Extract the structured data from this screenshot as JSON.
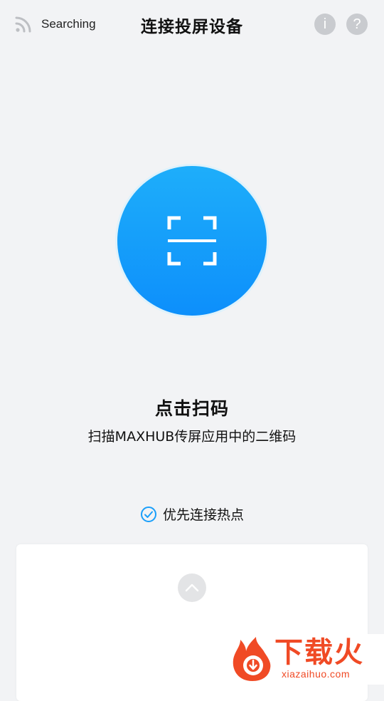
{
  "header": {
    "status": "Searching",
    "title": "连接投屏设备",
    "info_icon": "i",
    "help_icon": "?"
  },
  "scan": {
    "heading": "点击扫码",
    "subtitle": "扫描MAXHUB传屏应用中的二维码"
  },
  "options": {
    "priority_hotspot_label": "优先连接热点",
    "priority_hotspot_checked": true
  },
  "watermark": {
    "text": "下载火",
    "url": "xiazaihuo.com"
  },
  "colors": {
    "accent": "#1a9ffa",
    "background": "#f2f3f5",
    "watermark": "#f04a25"
  },
  "icons": {
    "status": "cast-icon",
    "scan": "qr-scan-icon",
    "check": "check-circle-icon",
    "expand": "chevron-up-icon",
    "info": "info-icon",
    "help": "help-icon"
  }
}
